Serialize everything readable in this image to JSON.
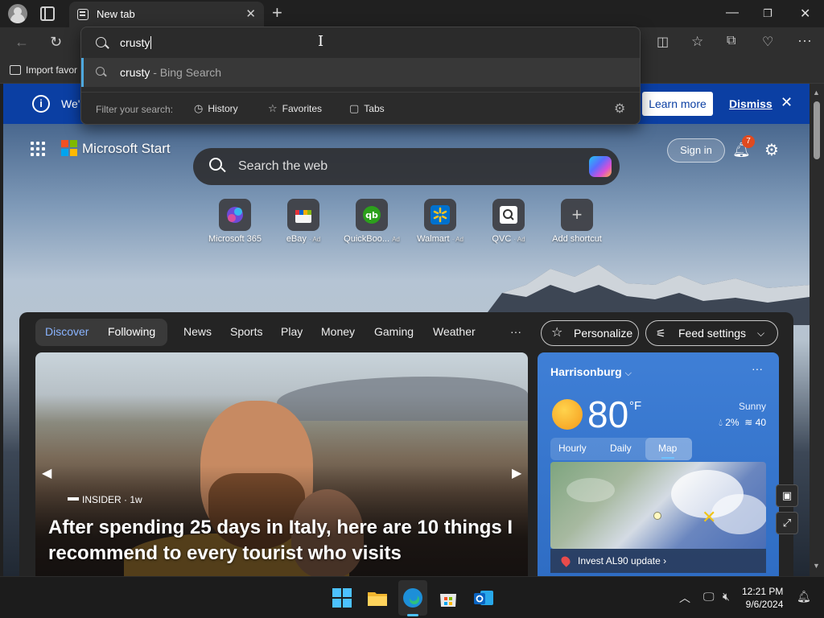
{
  "browser": {
    "tab_title": "New tab",
    "bookmark_item": "Import favor",
    "address_input": "crusty"
  },
  "dropdown": {
    "suggestion_query": "crusty",
    "suggestion_suffix": "- Bing Search",
    "filter_label": "Filter your search:",
    "filters": [
      {
        "label": "History",
        "icon": "history-icon"
      },
      {
        "label": "Favorites",
        "icon": "star-icon"
      },
      {
        "label": "Tabs",
        "icon": "tabs-icon"
      }
    ]
  },
  "infobar": {
    "text": "We'",
    "learn_more": "Learn more",
    "dismiss": "Dismiss"
  },
  "header": {
    "brand": "Microsoft Start",
    "sign_in": "Sign in",
    "notification_count": "7",
    "search_placeholder": "Search the web"
  },
  "shortcuts": [
    {
      "label": "Microsoft 365",
      "ad": ""
    },
    {
      "label": "eBay",
      "ad": "· Ad"
    },
    {
      "label": "QuickBoo...",
      "ad": "Ad"
    },
    {
      "label": "Walmart",
      "ad": "· Ad"
    },
    {
      "label": "QVC",
      "ad": "· Ad"
    },
    {
      "label": "Add shortcut",
      "ad": ""
    }
  ],
  "feed_nav": {
    "discover": "Discover",
    "following": "Following",
    "links": [
      "News",
      "Sports",
      "Play",
      "Money",
      "Gaming",
      "Weather"
    ],
    "more": "···",
    "personalize": "Personalize",
    "feed_settings": "Feed settings"
  },
  "hero": {
    "source": "INSIDER · 1w",
    "title": "After spending 25 days in Italy, here are 10 things I recommend to every tourist who visits"
  },
  "weather": {
    "city": "Harrisonburg",
    "temperature": "80",
    "unit": "°F",
    "condition": "Sunny",
    "precip": "2%",
    "wind": "40",
    "tabs": [
      "Hourly",
      "Daily",
      "Map"
    ],
    "active_tab": "Map",
    "alert": "Invest AL90 update"
  },
  "taskbar": {
    "time": "12:21 PM",
    "date": "9/6/2024"
  },
  "colors": {
    "accent": "#0b3fa3",
    "weather_card": "#2e6cc3",
    "taskbar_indicator": "#4cc2ff"
  }
}
